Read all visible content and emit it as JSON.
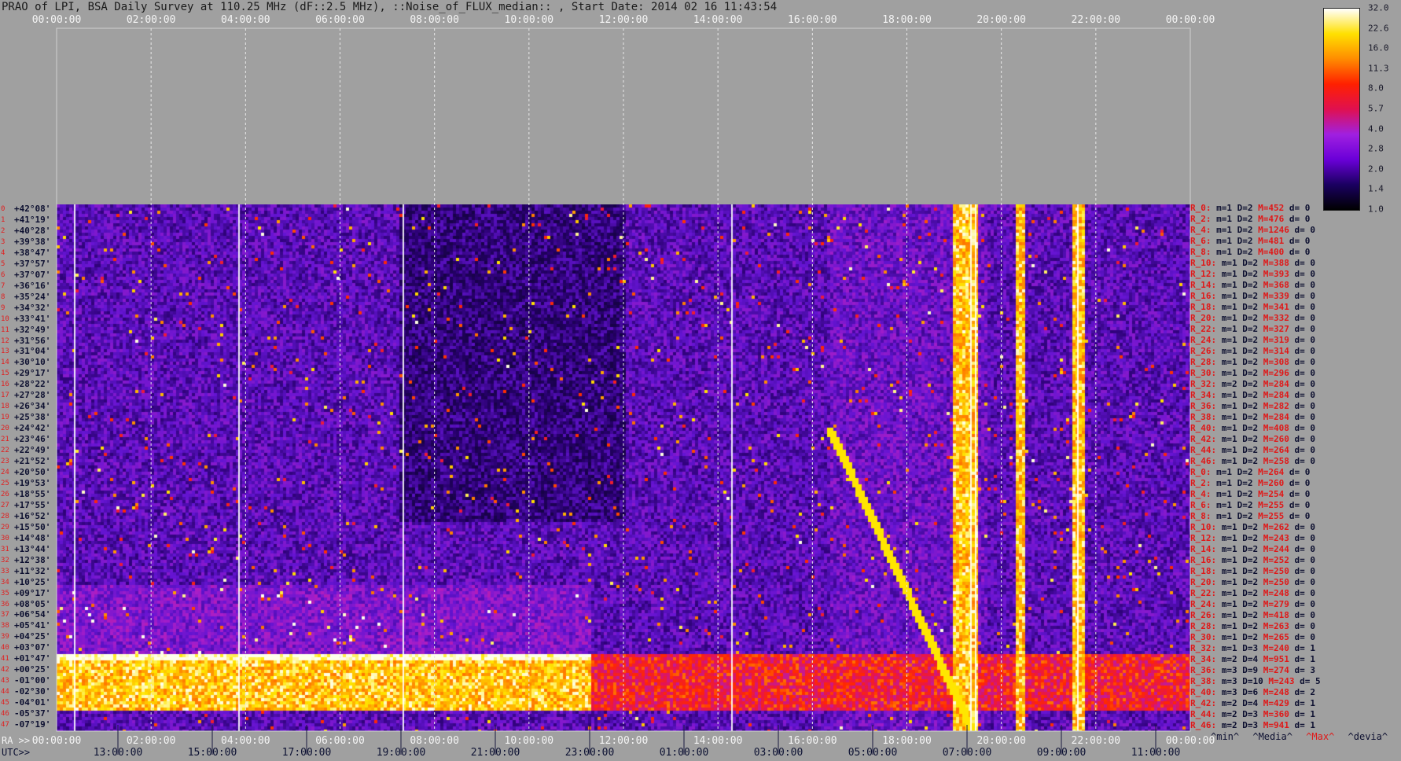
{
  "title": "PRAO of LPI, BSA Daily Survey at 110.25 MHz (dF::2.5 MHz), ::Noise_of_FLUX_median:: , Start Date: 2014 02 16 11:43:54",
  "top_axis": {
    "ticks": [
      "00:00:00",
      "02:00:00",
      "04:00:00",
      "06:00:00",
      "08:00:00",
      "10:00:00",
      "12:00:00",
      "14:00:00",
      "16:00:00",
      "18:00:00",
      "20:00:00",
      "22:00:00",
      "00:00:00"
    ]
  },
  "bottom_ra_axis": {
    "prefix": "RA >>",
    "ticks": [
      "00:00:00",
      "02:00:00",
      "04:00:00",
      "06:00:00",
      "08:00:00",
      "10:00:00",
      "12:00:00",
      "14:00:00",
      "16:00:00",
      "18:00:00",
      "20:00:00",
      "22:00:00",
      "00:00:00"
    ]
  },
  "bottom_utc_axis": {
    "prefix": "UTC>>",
    "ticks": [
      "13:00:00",
      "15:00:00",
      "17:00:00",
      "19:00:00",
      "21:00:00",
      "23:00:00",
      "01:00:00",
      "03:00:00",
      "05:00:00",
      "07:00:00",
      "09:00:00",
      "11:00:00"
    ]
  },
  "declination_labels": [
    "+42°08'",
    "+41°19'",
    "+40°28'",
    "+39°38'",
    "+38°47'",
    "+37°57'",
    "+37°07'",
    "+36°16'",
    "+35°24'",
    "+34°32'",
    "+33°41'",
    "+32°49'",
    "+31°56'",
    "+31°04'",
    "+30°10'",
    "+29°17'",
    "+28°22'",
    "+27°28'",
    "+26°34'",
    "+25°38'",
    "+24°42'",
    "+23°46'",
    "+22°49'",
    "+21°52'",
    "+20°50'",
    "+19°53'",
    "+18°55'",
    "+17°55'",
    "+16°52'",
    "+15°50'",
    "+14°48'",
    "+13°44'",
    "+12°38'",
    "+11°32'",
    "+10°25'",
    "+09°17'",
    "+08°05'",
    "+06°54'",
    "+05°41'",
    "+04°25'",
    "+03°07'",
    "+01°47'",
    "+00°25'",
    "-01°00'",
    "-02°30'",
    "-04°01'",
    "-05°37'",
    "-07°19'"
  ],
  "row_numbers": [
    "0",
    "1",
    "2",
    "3",
    "4",
    "5",
    "6",
    "7",
    "8",
    "9",
    "10",
    "11",
    "12",
    "13",
    "14",
    "15",
    "16",
    "17",
    "18",
    "19",
    "20",
    "21",
    "22",
    "23",
    "24",
    "25",
    "26",
    "27",
    "28",
    "29",
    "30",
    "31",
    "32",
    "33",
    "34",
    "35",
    "36",
    "37",
    "38",
    "39",
    "40",
    "41",
    "42",
    "43",
    "44",
    "45",
    "46",
    "47"
  ],
  "stats": [
    {
      "r": "R_0:",
      "m": "m=1",
      "d": "D=2",
      "M": "M=452",
      "dv": "d= 0"
    },
    {
      "r": "R_2:",
      "m": "m=1",
      "d": "D=2",
      "M": "M=476",
      "dv": "d= 0"
    },
    {
      "r": "R_4:",
      "m": "m=1",
      "d": "D=2",
      "M": "M=1246",
      "dv": "d= 0"
    },
    {
      "r": "R_6:",
      "m": "m=1",
      "d": "D=2",
      "M": "M=481",
      "dv": "d= 0"
    },
    {
      "r": "R_8:",
      "m": "m=1",
      "d": "D=2",
      "M": "M=400",
      "dv": "d= 0"
    },
    {
      "r": "R_10:",
      "m": "m=1",
      "d": "D=2",
      "M": "M=388",
      "dv": "d= 0"
    },
    {
      "r": "R_12:",
      "m": "m=1",
      "d": "D=2",
      "M": "M=393",
      "dv": "d= 0"
    },
    {
      "r": "R_14:",
      "m": "m=1",
      "d": "D=2",
      "M": "M=368",
      "dv": "d= 0"
    },
    {
      "r": "R_16:",
      "m": "m=1",
      "d": "D=2",
      "M": "M=339",
      "dv": "d= 0"
    },
    {
      "r": "R_18:",
      "m": "m=1",
      "d": "D=2",
      "M": "M=341",
      "dv": "d= 0"
    },
    {
      "r": "R_20:",
      "m": "m=1",
      "d": "D=2",
      "M": "M=332",
      "dv": "d= 0"
    },
    {
      "r": "R_22:",
      "m": "m=1",
      "d": "D=2",
      "M": "M=327",
      "dv": "d= 0"
    },
    {
      "r": "R_24:",
      "m": "m=1",
      "d": "D=2",
      "M": "M=319",
      "dv": "d= 0"
    },
    {
      "r": "R_26:",
      "m": "m=1",
      "d": "D=2",
      "M": "M=314",
      "dv": "d= 0"
    },
    {
      "r": "R_28:",
      "m": "m=1",
      "d": "D=2",
      "M": "M=308",
      "dv": "d= 0"
    },
    {
      "r": "R_30:",
      "m": "m=1",
      "d": "D=2",
      "M": "M=296",
      "dv": "d= 0"
    },
    {
      "r": "R_32:",
      "m": "m=2",
      "d": "D=2",
      "M": "M=284",
      "dv": "d= 0"
    },
    {
      "r": "R_34:",
      "m": "m=1",
      "d": "D=2",
      "M": "M=284",
      "dv": "d= 0"
    },
    {
      "r": "R_36:",
      "m": "m=1",
      "d": "D=2",
      "M": "M=282",
      "dv": "d= 0"
    },
    {
      "r": "R_38:",
      "m": "m=1",
      "d": "D=2",
      "M": "M=284",
      "dv": "d= 0"
    },
    {
      "r": "R_40:",
      "m": "m=1",
      "d": "D=2",
      "M": "M=408",
      "dv": "d= 0"
    },
    {
      "r": "R_42:",
      "m": "m=1",
      "d": "D=2",
      "M": "M=260",
      "dv": "d= 0"
    },
    {
      "r": "R_44:",
      "m": "m=1",
      "d": "D=2",
      "M": "M=264",
      "dv": "d= 0"
    },
    {
      "r": "R_46:",
      "m": "m=1",
      "d": "D=2",
      "M": "M=258",
      "dv": "d= 0"
    },
    {
      "r": "R_0:",
      "m": "m=1",
      "d": "D=2",
      "M": "M=264",
      "dv": "d= 0"
    },
    {
      "r": "R_2:",
      "m": "m=1",
      "d": "D=2",
      "M": "M=260",
      "dv": "d= 0"
    },
    {
      "r": "R_4:",
      "m": "m=1",
      "d": "D=2",
      "M": "M=254",
      "dv": "d= 0"
    },
    {
      "r": "R_6:",
      "m": "m=1",
      "d": "D=2",
      "M": "M=255",
      "dv": "d= 0"
    },
    {
      "r": "R_8:",
      "m": "m=1",
      "d": "D=2",
      "M": "M=255",
      "dv": "d= 0"
    },
    {
      "r": "R_10:",
      "m": "m=1",
      "d": "D=2",
      "M": "M=262",
      "dv": "d= 0"
    },
    {
      "r": "R_12:",
      "m": "m=1",
      "d": "D=2",
      "M": "M=243",
      "dv": "d= 0"
    },
    {
      "r": "R_14:",
      "m": "m=1",
      "d": "D=2",
      "M": "M=244",
      "dv": "d= 0"
    },
    {
      "r": "R_16:",
      "m": "m=1",
      "d": "D=2",
      "M": "M=252",
      "dv": "d= 0"
    },
    {
      "r": "R_18:",
      "m": "m=1",
      "d": "D=2",
      "M": "M=250",
      "dv": "d= 0"
    },
    {
      "r": "R_20:",
      "m": "m=1",
      "d": "D=2",
      "M": "M=250",
      "dv": "d= 0"
    },
    {
      "r": "R_22:",
      "m": "m=1",
      "d": "D=2",
      "M": "M=248",
      "dv": "d= 0"
    },
    {
      "r": "R_24:",
      "m": "m=1",
      "d": "D=2",
      "M": "M=279",
      "dv": "d= 0"
    },
    {
      "r": "R_26:",
      "m": "m=1",
      "d": "D=2",
      "M": "M=418",
      "dv": "d= 0"
    },
    {
      "r": "R_28:",
      "m": "m=1",
      "d": "D=2",
      "M": "M=263",
      "dv": "d= 0"
    },
    {
      "r": "R_30:",
      "m": "m=1",
      "d": "D=2",
      "M": "M=265",
      "dv": "d= 0"
    },
    {
      "r": "R_32:",
      "m": "m=1",
      "d": "D=3",
      "M": "M=240",
      "dv": "d= 1"
    },
    {
      "r": "R_34:",
      "m": "m=2",
      "d": "D=4",
      "M": "M=951",
      "dv": "d= 1"
    },
    {
      "r": "R_36:",
      "m": "m=3",
      "d": "D=9",
      "M": "M=274",
      "dv": "d= 3"
    },
    {
      "r": "R_38:",
      "m": "m=3",
      "d": "D=10",
      "M": "M=243",
      "dv": "d= 5"
    },
    {
      "r": "R_40:",
      "m": "m=3",
      "d": "D=6",
      "M": "M=248",
      "dv": "d= 2"
    },
    {
      "r": "R_42:",
      "m": "m=2",
      "d": "D=4",
      "M": "M=429",
      "dv": "d= 1"
    },
    {
      "r": "R_44:",
      "m": "m=2",
      "d": "D=3",
      "M": "M=360",
      "dv": "d= 1"
    },
    {
      "r": "R_46:",
      "m": "m=2",
      "d": "D=3",
      "M": "M=941",
      "dv": "d= 1"
    }
  ],
  "stat_legend": {
    "min": "^min^",
    "media": "^Media^",
    "max": "^Max^",
    "devia": "^devia^"
  },
  "colorbar": {
    "labels": [
      "32.0",
      "22.6",
      "16.0",
      "11.3",
      "8.0",
      "5.7",
      "4.0",
      "2.8",
      "2.0",
      "1.4",
      "1.0"
    ],
    "colors": {
      "min": "#000000",
      "c1": "#1a0060",
      "c2": "#6a00d8",
      "c3": "#a020e0",
      "c4": "#e01050",
      "c5": "#ff2000",
      "c6": "#ff8c00",
      "c7": "#ffe000",
      "max": "#ffffff"
    }
  },
  "chart_data": {
    "type": "heatmap",
    "title": "PRAO of LPI, BSA Daily Survey at 110.25 MHz (dF::2.5 MHz), ::Noise_of_FLUX_median:: , Start Date: 2014 02 16 11:43:54",
    "x_axis_top": "RA 00:00:00 to 24:00:00",
    "rows": 48,
    "value_scale": "log2",
    "value_range": [
      1.0,
      32.0
    ]
  }
}
